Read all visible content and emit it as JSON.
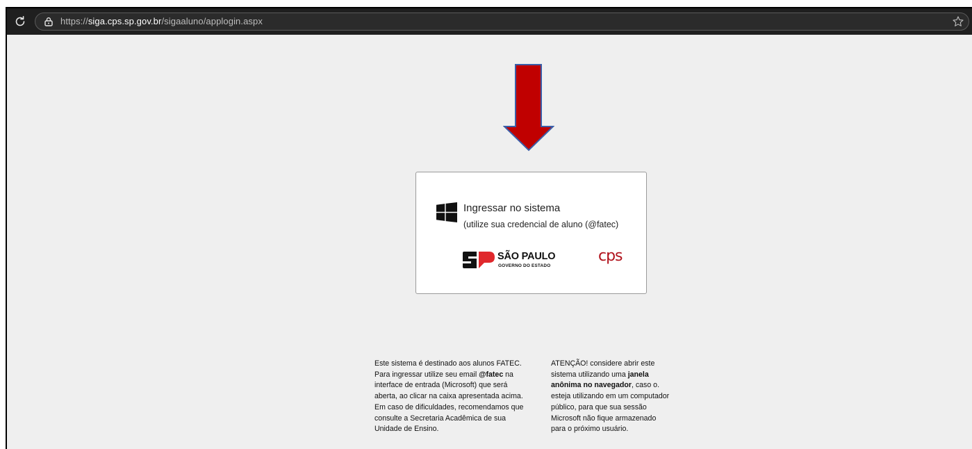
{
  "browser": {
    "url_prefix": "https://",
    "url_host": "siga.cps.sp.gov.br",
    "url_path": "/sigaaluno/applogin.aspx"
  },
  "login_card": {
    "title": "Ingressar no sistema",
    "subtitle": "(utilize sua credencial de aluno (@fatec)",
    "sp_logo_name": "SÃO PAULO",
    "sp_logo_sub": "GOVERNO DO ESTADO",
    "cps_logo": "cps"
  },
  "notes": {
    "left": [
      "Este sistema é destinado aos alunos FATEC.",
      "Para ingressar utilize seu email",
      "@fatec",
      " na",
      "interface de entrada (Microsoft) que será",
      "aberta, ao clicar na caixa apresentada acima.",
      "Em caso de dificuldades, recomendamos que",
      "consulte a Secretaria Acadêmica de sua",
      "Unidade de Ensino."
    ],
    "right": [
      "ATENÇÃO! considere abrir este",
      "sistema utilizando uma ",
      "janela",
      "anônima no navegador",
      ", caso o.",
      "esteja utilizando em um computador",
      "público, para que sua sessão",
      "Microsoft não fique armazenado",
      "para o próximo usuário."
    ]
  },
  "colors": {
    "arrow_fill": "#c00000",
    "arrow_stroke": "#3b5ea8",
    "cps_red": "#b1121c"
  },
  "icons": [
    "reload-icon",
    "lock-icon",
    "bookmark-star-icon",
    "windows-logo-icon",
    "down-arrow"
  ]
}
